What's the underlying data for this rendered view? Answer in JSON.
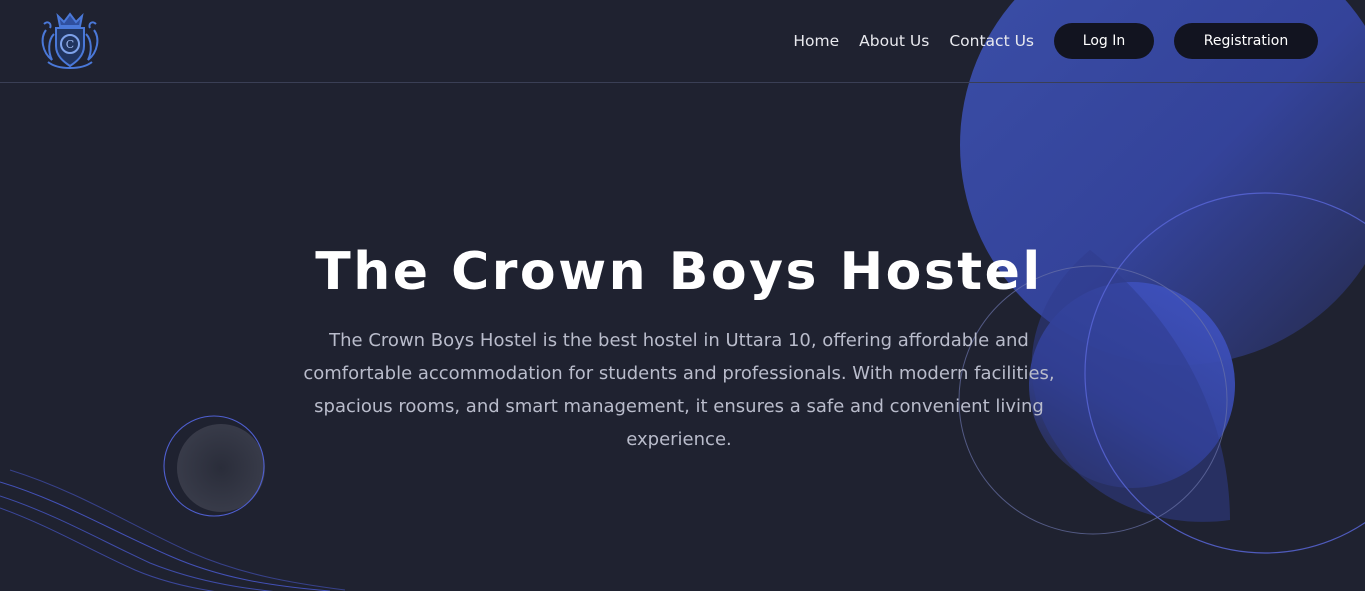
{
  "nav": {
    "logo_name": "crown-crest-logo",
    "links": [
      {
        "label": "Home"
      },
      {
        "label": "About Us"
      },
      {
        "label": "Contact Us"
      }
    ],
    "login_label": "Log In",
    "register_label": "Registration"
  },
  "hero": {
    "title": "The Crown Boys Hostel",
    "description": "The Crown Boys Hostel is the best hostel in Uttara 10, offering affordable and comfortable accommodation for students and professionals. With modern facilities, spacious rooms, and smart management, it ensures a safe and convenient living experience."
  },
  "colors": {
    "background": "#1f2230",
    "accent_blue": "#3f51b5",
    "button_bg": "#121420",
    "text_muted": "#b9bccb"
  }
}
